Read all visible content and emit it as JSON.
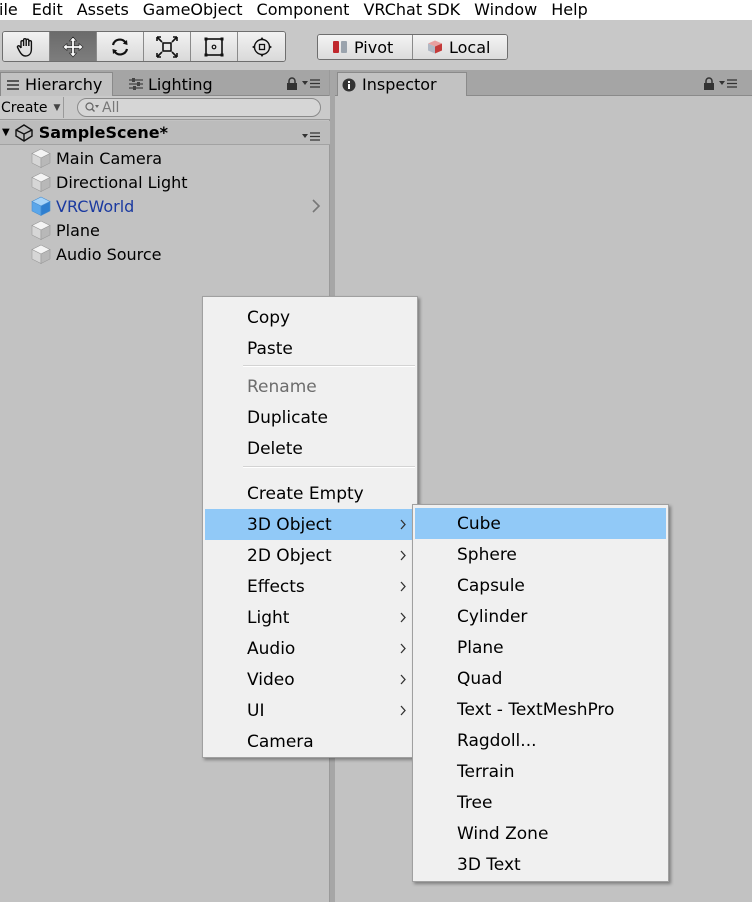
{
  "menubar": {
    "items": [
      "ile",
      "Edit",
      "Assets",
      "GameObject",
      "Component",
      "VRChat SDK",
      "Window",
      "Help"
    ]
  },
  "toolbar": {
    "tools": [
      {
        "icon": "hand-icon",
        "active": false
      },
      {
        "icon": "move-icon",
        "active": true
      },
      {
        "icon": "rotate-icon",
        "active": false
      },
      {
        "icon": "scale-icon",
        "active": false
      },
      {
        "icon": "rect-tool-icon",
        "active": false
      },
      {
        "icon": "transform-icon",
        "active": false
      }
    ],
    "pivot_label": "Pivot",
    "local_label": "Local"
  },
  "hierarchy": {
    "tabs": {
      "hierarchy": "Hierarchy",
      "lighting": "Lighting"
    },
    "create_label": "Create",
    "search_placeholder": "All",
    "scene_name": "SampleScene*",
    "items": [
      {
        "label": "Main Camera",
        "selected": false
      },
      {
        "label": "Directional Light",
        "selected": false
      },
      {
        "label": "VRCWorld",
        "selected": true
      },
      {
        "label": "Plane",
        "selected": false
      },
      {
        "label": "Audio Source",
        "selected": false
      }
    ]
  },
  "inspector": {
    "tab_label": "Inspector"
  },
  "context_menu": {
    "items": [
      {
        "label": "Copy"
      },
      {
        "label": "Paste"
      },
      {
        "label": "Rename",
        "disabled": true
      },
      {
        "label": "Duplicate"
      },
      {
        "label": "Delete"
      },
      {
        "label": "Create Empty"
      },
      {
        "label": "3D Object",
        "submenu": true,
        "highlighted": true
      },
      {
        "label": "2D Object",
        "submenu": true
      },
      {
        "label": "Effects",
        "submenu": true
      },
      {
        "label": "Light",
        "submenu": true
      },
      {
        "label": "Audio",
        "submenu": true
      },
      {
        "label": "Video",
        "submenu": true
      },
      {
        "label": "UI",
        "submenu": true
      },
      {
        "label": "Camera"
      }
    ]
  },
  "submenu_3d": {
    "items": [
      "Cube",
      "Sphere",
      "Capsule",
      "Cylinder",
      "Plane",
      "Quad",
      "Text - TextMeshPro",
      "Ragdoll...",
      "Terrain",
      "Tree",
      "Wind Zone",
      "3D Text"
    ]
  },
  "colors": {
    "highlight": "#91c9f7",
    "selected_text": "#1b3aa0",
    "panel_bg": "#c2c2c2",
    "menu_bg": "#f0f0f0"
  }
}
